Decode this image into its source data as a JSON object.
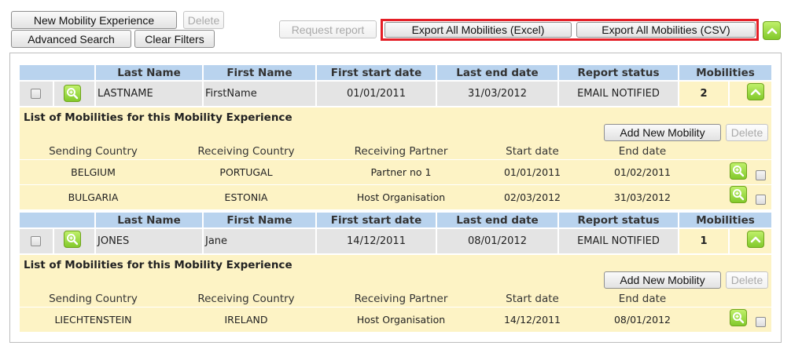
{
  "toolbar": {
    "new_mobility_experience": "New Mobility Experience",
    "delete": "Delete",
    "advanced_search": "Advanced Search",
    "clear_filters": "Clear Filters",
    "request_report": "Request report",
    "export_excel": "Export All Mobilities (Excel)",
    "export_csv": "Export All Mobilities (CSV)"
  },
  "experience_headers": [
    "Last Name",
    "First Name",
    "First start date",
    "Last end date",
    "Report status",
    "Mobilities"
  ],
  "mobility_headers": [
    "Sending Country",
    "Receiving Country",
    "Receiving Partner",
    "Start date",
    "End date"
  ],
  "list_title": "List of Mobilities for this Mobility Experience",
  "add_new_mobility": "Add New Mobility",
  "delete_label": "Delete",
  "experiences": [
    {
      "last_name": "LASTNAME",
      "first_name": "FirstName",
      "first_start_date": "01/01/2011",
      "last_end_date": "31/03/2012",
      "report_status": "EMAIL NOTIFIED",
      "mobilities_count": "2",
      "mobilities": [
        {
          "sending_country": "BELGIUM",
          "receiving_country": "PORTUGAL",
          "receiving_partner": "Partner no 1",
          "start_date": "01/01/2011",
          "end_date": "01/02/2011"
        },
        {
          "sending_country": "BULGARIA",
          "receiving_country": "ESTONIA",
          "receiving_partner": "Host Organisation",
          "start_date": "02/03/2012",
          "end_date": "31/03/2012"
        }
      ]
    },
    {
      "last_name": "JONES",
      "first_name": "Jane",
      "first_start_date": "14/12/2011",
      "last_end_date": "08/01/2012",
      "report_status": "EMAIL NOTIFIED",
      "mobilities_count": "1",
      "mobilities": [
        {
          "sending_country": "LIECHTENSTEIN",
          "receiving_country": "IRELAND",
          "receiving_partner": "Host Organisation",
          "start_date": "14/12/2011",
          "end_date": "08/01/2012"
        }
      ]
    }
  ],
  "colors": {
    "header_blue": "#b9d3ee",
    "row_grey": "#e4e4e4",
    "list_yellow": "#fdf3c5",
    "highlight_red": "#e41e26",
    "icon_green": "#8fd13a"
  },
  "icons": [
    "magnifier-zoom-icon",
    "chevron-up-icon"
  ]
}
